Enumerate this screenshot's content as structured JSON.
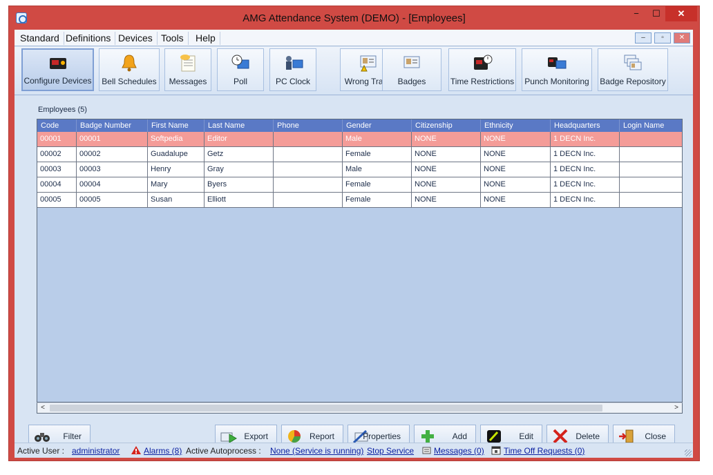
{
  "window": {
    "title": "AMG Attendance System (DEMO) - [Employees]",
    "controls": {
      "minimize": "−",
      "maximize": "☐",
      "close": "✕"
    }
  },
  "menu": {
    "items": [
      "Standard",
      "Definitions",
      "Devices",
      "Tools",
      "Help"
    ],
    "mdi": {
      "minimize": "–",
      "restore": "▫",
      "close": "✕"
    }
  },
  "toolbar": {
    "buttons": [
      {
        "label": "Configure Devices",
        "icon": "device-icon"
      },
      {
        "label": "Bell Schedules",
        "icon": "bell-icon"
      },
      {
        "label": "Messages",
        "icon": "messages-icon"
      },
      {
        "label": "Poll",
        "icon": "poll-icon"
      },
      {
        "label": "PC Clock",
        "icon": "pc-clock-icon"
      },
      {
        "label": "Wrong Trans",
        "icon": "wrong-trans-icon"
      },
      {
        "label": "Badges",
        "icon": "badges-icon"
      },
      {
        "label": "Time Restrictions",
        "icon": "time-restrictions-icon"
      },
      {
        "label": "Punch Monitoring",
        "icon": "punch-monitoring-icon"
      },
      {
        "label": "Badge Repository",
        "icon": "badge-repository-icon"
      }
    ]
  },
  "employees": {
    "header": "Employees (5)",
    "columns": [
      "Code",
      "Badge Number",
      "First Name",
      "Last Name",
      "Phone",
      "Gender",
      "Citizenship",
      "Ethnicity",
      "Headquarters",
      "Login Name"
    ],
    "rows": [
      [
        "00001",
        "00001",
        "Softpedia",
        "Editor",
        "",
        "Male",
        "NONE",
        "NONE",
        "1   DECN Inc.",
        ""
      ],
      [
        "00002",
        "00002",
        "Guadalupe",
        "Getz",
        "",
        "Female",
        "NONE",
        "NONE",
        "1   DECN Inc.",
        ""
      ],
      [
        "00003",
        "00003",
        "Henry",
        "Gray",
        "",
        "Male",
        "NONE",
        "NONE",
        "1   DECN Inc.",
        ""
      ],
      [
        "00004",
        "00004",
        "Mary",
        "Byers",
        "",
        "Female",
        "NONE",
        "NONE",
        "1   DECN Inc.",
        ""
      ],
      [
        "00005",
        "00005",
        "Susan",
        "Elliott",
        "",
        "Female",
        "NONE",
        "NONE",
        "1   DECN Inc.",
        ""
      ]
    ]
  },
  "scroll": {
    "left": "<",
    "right": ">"
  },
  "actions": {
    "filter": "Filter",
    "export": "Export",
    "report": "Report",
    "properties": "Properties",
    "add": "Add",
    "edit": "Edit",
    "delete": "Delete",
    "close": "Close"
  },
  "status": {
    "active_user_label": "Active User   :",
    "active_user": "administrator",
    "alarms": "Alarms (8)",
    "autoprocess_label": "Active Autoprocess   :",
    "autoprocess": "None (Service is running)",
    "stop_service": "Stop Service",
    "messages": "Messages (0)",
    "time_off": "Time Off Requests (0)"
  },
  "colors": {
    "accent": "#5a79c5",
    "selected_row": "#f49c98",
    "window_frame": "#d04a44"
  }
}
